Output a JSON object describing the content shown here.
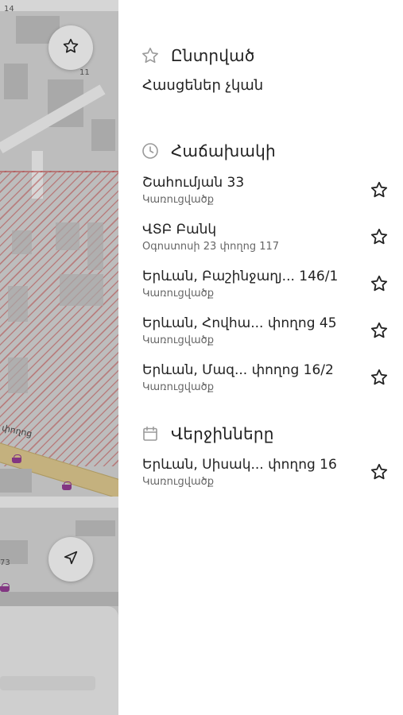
{
  "map": {
    "street_label": "փողոց",
    "numbers": [
      "14",
      "11",
      "73"
    ]
  },
  "drawer": {
    "favorites": {
      "title": "Ընտրված",
      "icon": "star-outline-icon",
      "empty_text": "Հասցեներ չկան"
    },
    "frequent": {
      "title": "Հաճախակի",
      "icon": "clock-icon",
      "items": [
        {
          "title": "Շահումյան 33",
          "subtitle": "Կառուցվածք"
        },
        {
          "title": "ՎՏԲ Բանկ",
          "subtitle": "Օգոստոսի 23 փողոց 117"
        },
        {
          "title": "Երևան, Բաշինջաղյ...  146/1",
          "subtitle": "Կառուցվածք"
        },
        {
          "title": "Երևան, Հովհա...  փողոց 45",
          "subtitle": "Կառուցվածք"
        },
        {
          "title": "Երևան, Մազ...  փողոց 16/2",
          "subtitle": "Կառուցվածք"
        }
      ]
    },
    "recent": {
      "title": "Վերջինները",
      "icon": "calendar-icon",
      "items": [
        {
          "title": "Երևան, Սիսակ...  փողոց 16",
          "subtitle": "Կառուցվածք"
        }
      ]
    }
  },
  "colors": {
    "drawer_bg": "#ffffff",
    "map_bg": "#c9c9c9",
    "hatch": "#be5050",
    "text_primary": "#222222",
    "text_secondary": "#666666"
  }
}
